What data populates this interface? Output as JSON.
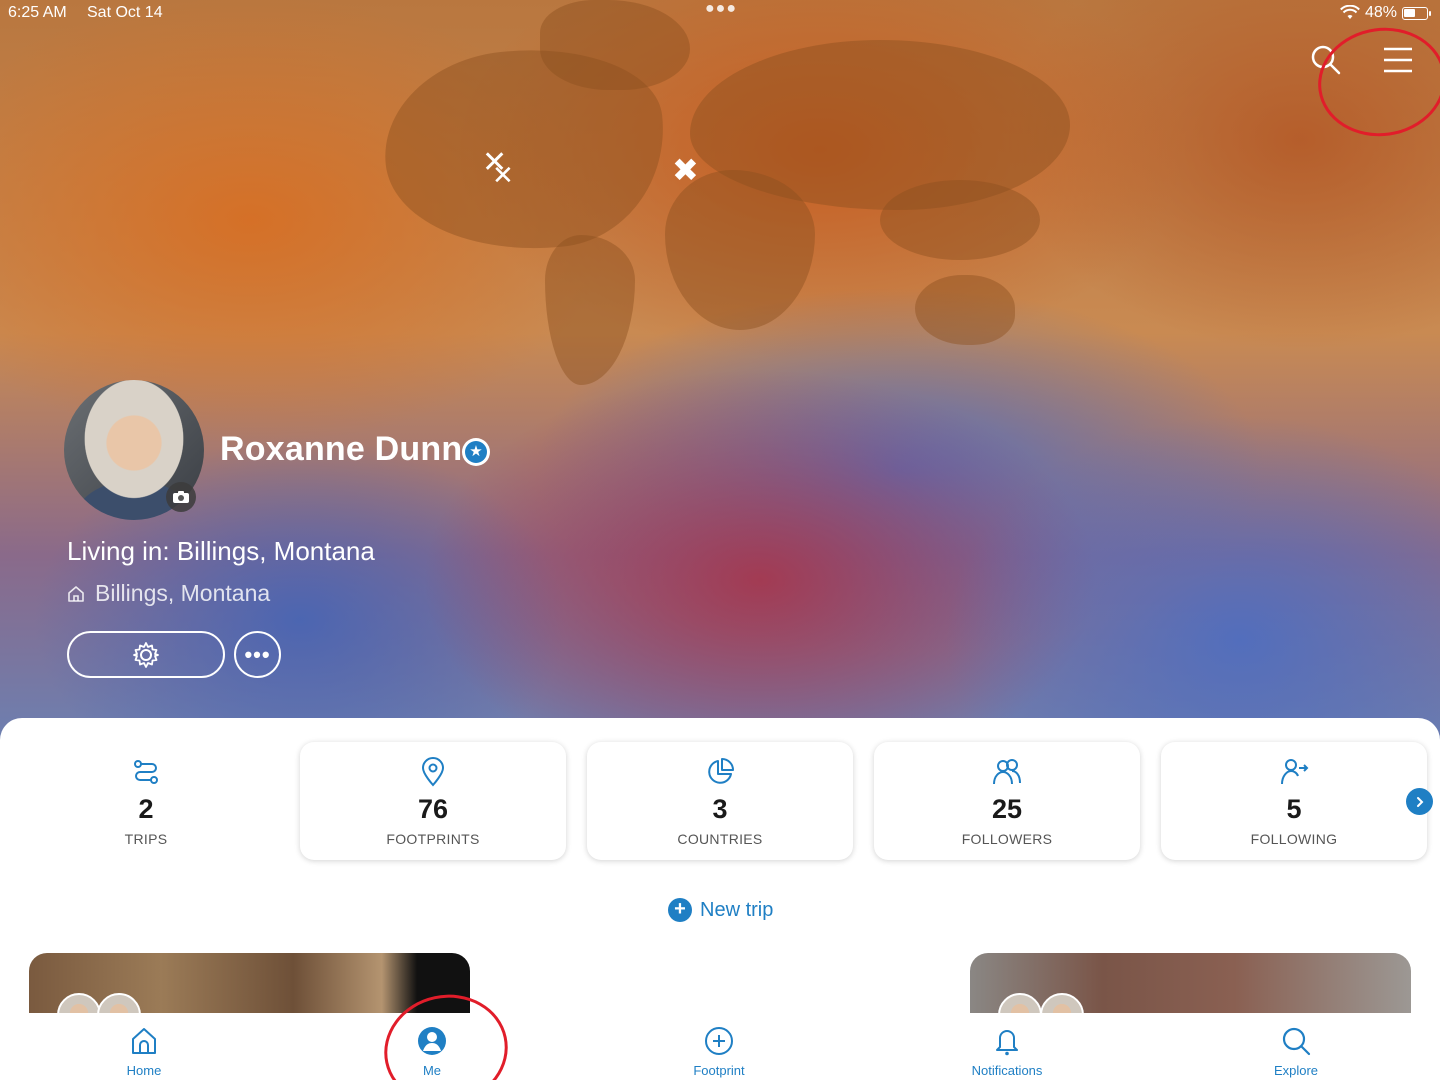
{
  "status_bar": {
    "time": "6:25 AM",
    "date": "Sat Oct 14",
    "battery": "48%"
  },
  "header": {
    "search_icon": "search-icon",
    "menu_icon": "hamburger-menu-icon"
  },
  "profile": {
    "name": "Roxanne Dunn",
    "living_in": "Living in: Billings, Montana",
    "home_location": "Billings, Montana"
  },
  "stats": [
    {
      "value": "2",
      "label": "TRIPS",
      "icon": "route-icon"
    },
    {
      "value": "76",
      "label": "FOOTPRINTS",
      "icon": "map-pin-icon"
    },
    {
      "value": "3",
      "label": "COUNTRIES",
      "icon": "pie-chart-icon"
    },
    {
      "value": "25",
      "label": "FOLLOWERS",
      "icon": "users-icon"
    },
    {
      "value": "5",
      "label": "FOLLOWING",
      "icon": "user-follow-icon"
    }
  ],
  "new_trip_label": "New trip",
  "tabs": [
    {
      "label": "Home",
      "icon": "home-icon"
    },
    {
      "label": "Me",
      "icon": "user-circle-icon"
    },
    {
      "label": "Footprint",
      "icon": "plus-circle-icon"
    },
    {
      "label": "Notifications",
      "icon": "bell-icon"
    },
    {
      "label": "Explore",
      "icon": "search-icon"
    }
  ],
  "colors": {
    "accent": "#1f7fc4",
    "annotation": "#e11d2a"
  }
}
